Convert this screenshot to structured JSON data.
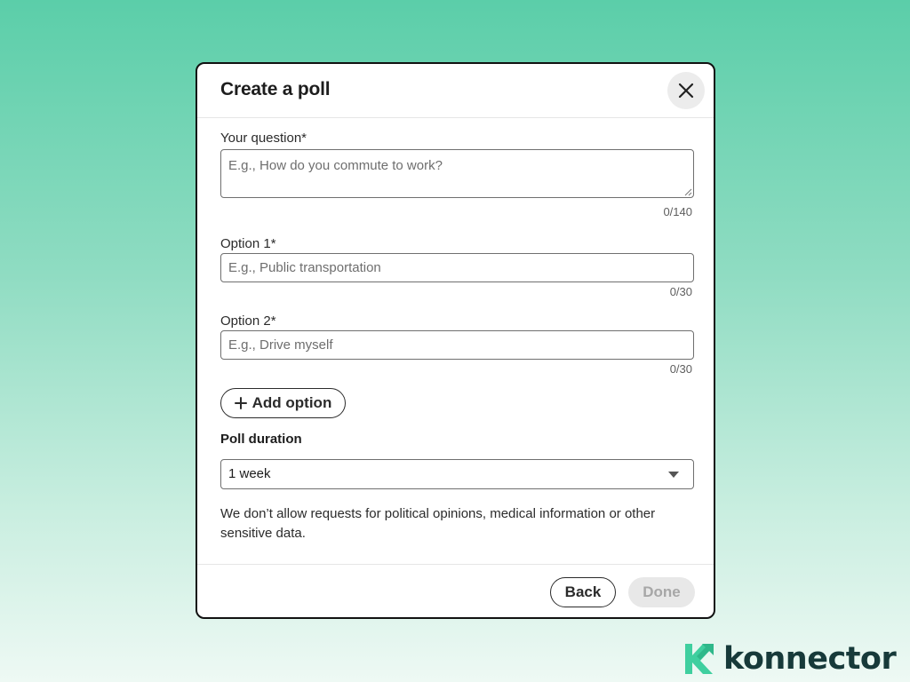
{
  "modal": {
    "title": "Create a poll",
    "close_icon": "close-icon"
  },
  "question": {
    "label": "Your question*",
    "placeholder": "E.g., How do you commute to work?",
    "counter": "0/140"
  },
  "options": [
    {
      "label": "Option 1*",
      "placeholder": "E.g., Public transportation",
      "counter": "0/30"
    },
    {
      "label": "Option 2*",
      "placeholder": "E.g., Drive myself",
      "counter": "0/30"
    }
  ],
  "add_option": {
    "icon": "plus-icon",
    "label": "Add option"
  },
  "duration": {
    "label": "Poll duration",
    "selected": "1 week"
  },
  "disclaimer": "We don’t allow requests for political opinions, medical information or other sensitive data.",
  "footer": {
    "back_label": "Back",
    "done_label": "Done"
  },
  "brand": {
    "name": "konnector",
    "logo_icon": "konnector-logo-icon",
    "colors": {
      "accent": "#3fcf9f",
      "text": "#173a3a"
    }
  }
}
